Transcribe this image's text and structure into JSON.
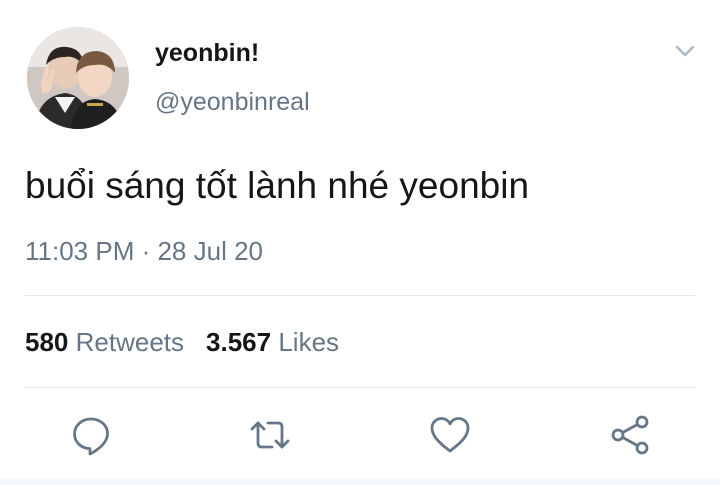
{
  "user": {
    "display_name": "yeonbin!",
    "handle": "@yeonbinreal"
  },
  "tweet": {
    "text": "buổi sáng tốt lành nhé yeonbin",
    "time": "11:03 PM",
    "separator": " · ",
    "date": "28 Jul 20"
  },
  "stats": {
    "retweets_count": "580",
    "retweets_label": "Retweets",
    "likes_count": "3.567",
    "likes_label": "Likes"
  },
  "icons": {
    "menu": "chevron-down-icon",
    "reply": "reply-icon",
    "retweet": "retweet-icon",
    "like": "heart-icon",
    "share": "share-icon"
  },
  "colors": {
    "text_primary": "#14171a",
    "text_secondary": "#657786",
    "icon": "#657786",
    "divider": "#e1e8ed"
  }
}
